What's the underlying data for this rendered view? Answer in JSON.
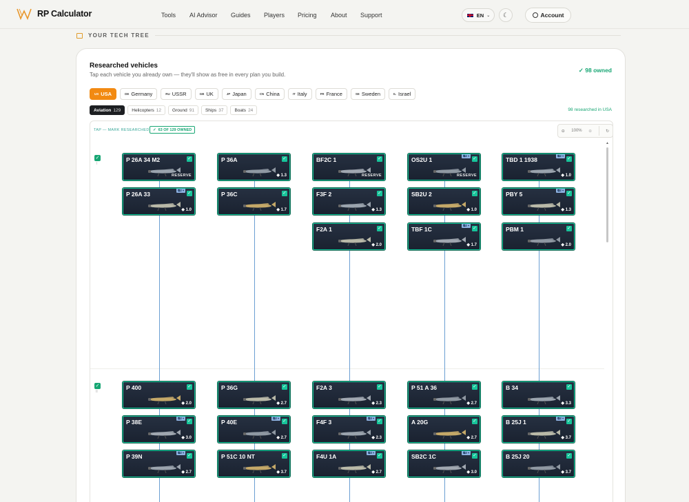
{
  "brand": {
    "name": "RP Calculator"
  },
  "nav": [
    "Tools",
    "AI Advisor",
    "Guides",
    "Players",
    "Pricing",
    "About",
    "Support"
  ],
  "header": {
    "lang": "EN",
    "account": "Account",
    "theme_icon": "moon-icon"
  },
  "section": {
    "title": "YOUR TECH TREE"
  },
  "card": {
    "title": "Researched vehicles",
    "subtitle": "Tap each vehicle you already own — they'll show as free in every plan you build.",
    "owned": "98 owned"
  },
  "countries": [
    {
      "code": "US",
      "label": "USA",
      "active": true
    },
    {
      "code": "DE",
      "label": "Germany"
    },
    {
      "code": "RU",
      "label": "USSR"
    },
    {
      "code": "GB",
      "label": "UK"
    },
    {
      "code": "JP",
      "label": "Japan"
    },
    {
      "code": "CN",
      "label": "China"
    },
    {
      "code": "IT",
      "label": "Italy"
    },
    {
      "code": "FR",
      "label": "France"
    },
    {
      "code": "SE",
      "label": "Sweden"
    },
    {
      "code": "IL",
      "label": "Israel"
    }
  ],
  "types": [
    {
      "label": "Aviation",
      "count": "129",
      "active": true
    },
    {
      "label": "Helicopters",
      "count": "12"
    },
    {
      "label": "Ground",
      "count": "91"
    },
    {
      "label": "Ships",
      "count": "37"
    },
    {
      "label": "Boats",
      "count": "24"
    }
  ],
  "researched_label": "98 researched in USA",
  "tree": {
    "hint": "TAP — MARK RESEARCHED",
    "owned_badge": "63 OF 129 OWNED",
    "zoom": "100%",
    "ranks": [
      {
        "num": "I"
      },
      {
        "num": "II"
      }
    ],
    "vehicles": [
      {
        "name": "P 26A 34 M2",
        "reserve": "RESERVE",
        "col": 0,
        "row": 0
      },
      {
        "name": "P 26A 33",
        "br": "1.0",
        "group": "2",
        "col": 0,
        "row": 1
      },
      {
        "name": "P 36A",
        "br": "1.3",
        "col": 1,
        "row": 0
      },
      {
        "name": "P 36C",
        "br": "1.7",
        "col": 1,
        "row": 1
      },
      {
        "name": "BF2C 1",
        "reserve": "RESERVE",
        "col": 2,
        "row": 0
      },
      {
        "name": "F3F 2",
        "br": "1.3",
        "col": 2,
        "row": 1
      },
      {
        "name": "F2A 1",
        "br": "2.0",
        "col": 2,
        "row": 2
      },
      {
        "name": "OS2U 1",
        "reserve": "RESERVE",
        "group": "2",
        "col": 3,
        "row": 0
      },
      {
        "name": "SB2U 2",
        "br": "1.0",
        "col": 3,
        "row": 1
      },
      {
        "name": "TBF 1C",
        "br": "1.7",
        "group": "2",
        "col": 3,
        "row": 2
      },
      {
        "name": "TBD 1 1938",
        "br": "1.0",
        "group": "2",
        "col": 4,
        "row": 0
      },
      {
        "name": "PBY 5",
        "br": "1.3",
        "group": "2",
        "col": 4,
        "row": 1
      },
      {
        "name": "PBM 1",
        "br": "2.0",
        "col": 4,
        "row": 2
      },
      {
        "name": "P 400",
        "br": "2.0",
        "col": 0,
        "row": 3
      },
      {
        "name": "P 38E",
        "br": "3.0",
        "group": "2",
        "col": 0,
        "row": 4
      },
      {
        "name": "P 39N",
        "br": "2.7",
        "group": "2",
        "col": 0,
        "row": 5
      },
      {
        "name": "P 36G",
        "br": "2.7",
        "col": 1,
        "row": 3
      },
      {
        "name": "P 40E",
        "br": "2.7",
        "group": "2",
        "col": 1,
        "row": 4
      },
      {
        "name": "P 51C 10 NT",
        "br": "3.7",
        "col": 1,
        "row": 5
      },
      {
        "name": "F2A 3",
        "br": "2.3",
        "col": 2,
        "row": 3
      },
      {
        "name": "F4F 3",
        "br": "2.3",
        "group": "3",
        "col": 2,
        "row": 4
      },
      {
        "name": "F4U 1A",
        "br": "2.7",
        "group": "3",
        "col": 2,
        "row": 5
      },
      {
        "name": "P 51 A 36",
        "br": "2.7",
        "col": 3,
        "row": 3
      },
      {
        "name": "A 20G",
        "br": "2.7",
        "col": 3,
        "row": 4
      },
      {
        "name": "SB2C 1C",
        "br": "3.0",
        "group": "2",
        "col": 3,
        "row": 5
      },
      {
        "name": "B 34",
        "br": "3.3",
        "col": 4,
        "row": 3
      },
      {
        "name": "B 25J 1",
        "br": "3.7",
        "group": "2",
        "col": 4,
        "row": 4
      },
      {
        "name": "B 25J 20",
        "br": "3.7",
        "col": 4,
        "row": 5
      }
    ]
  }
}
